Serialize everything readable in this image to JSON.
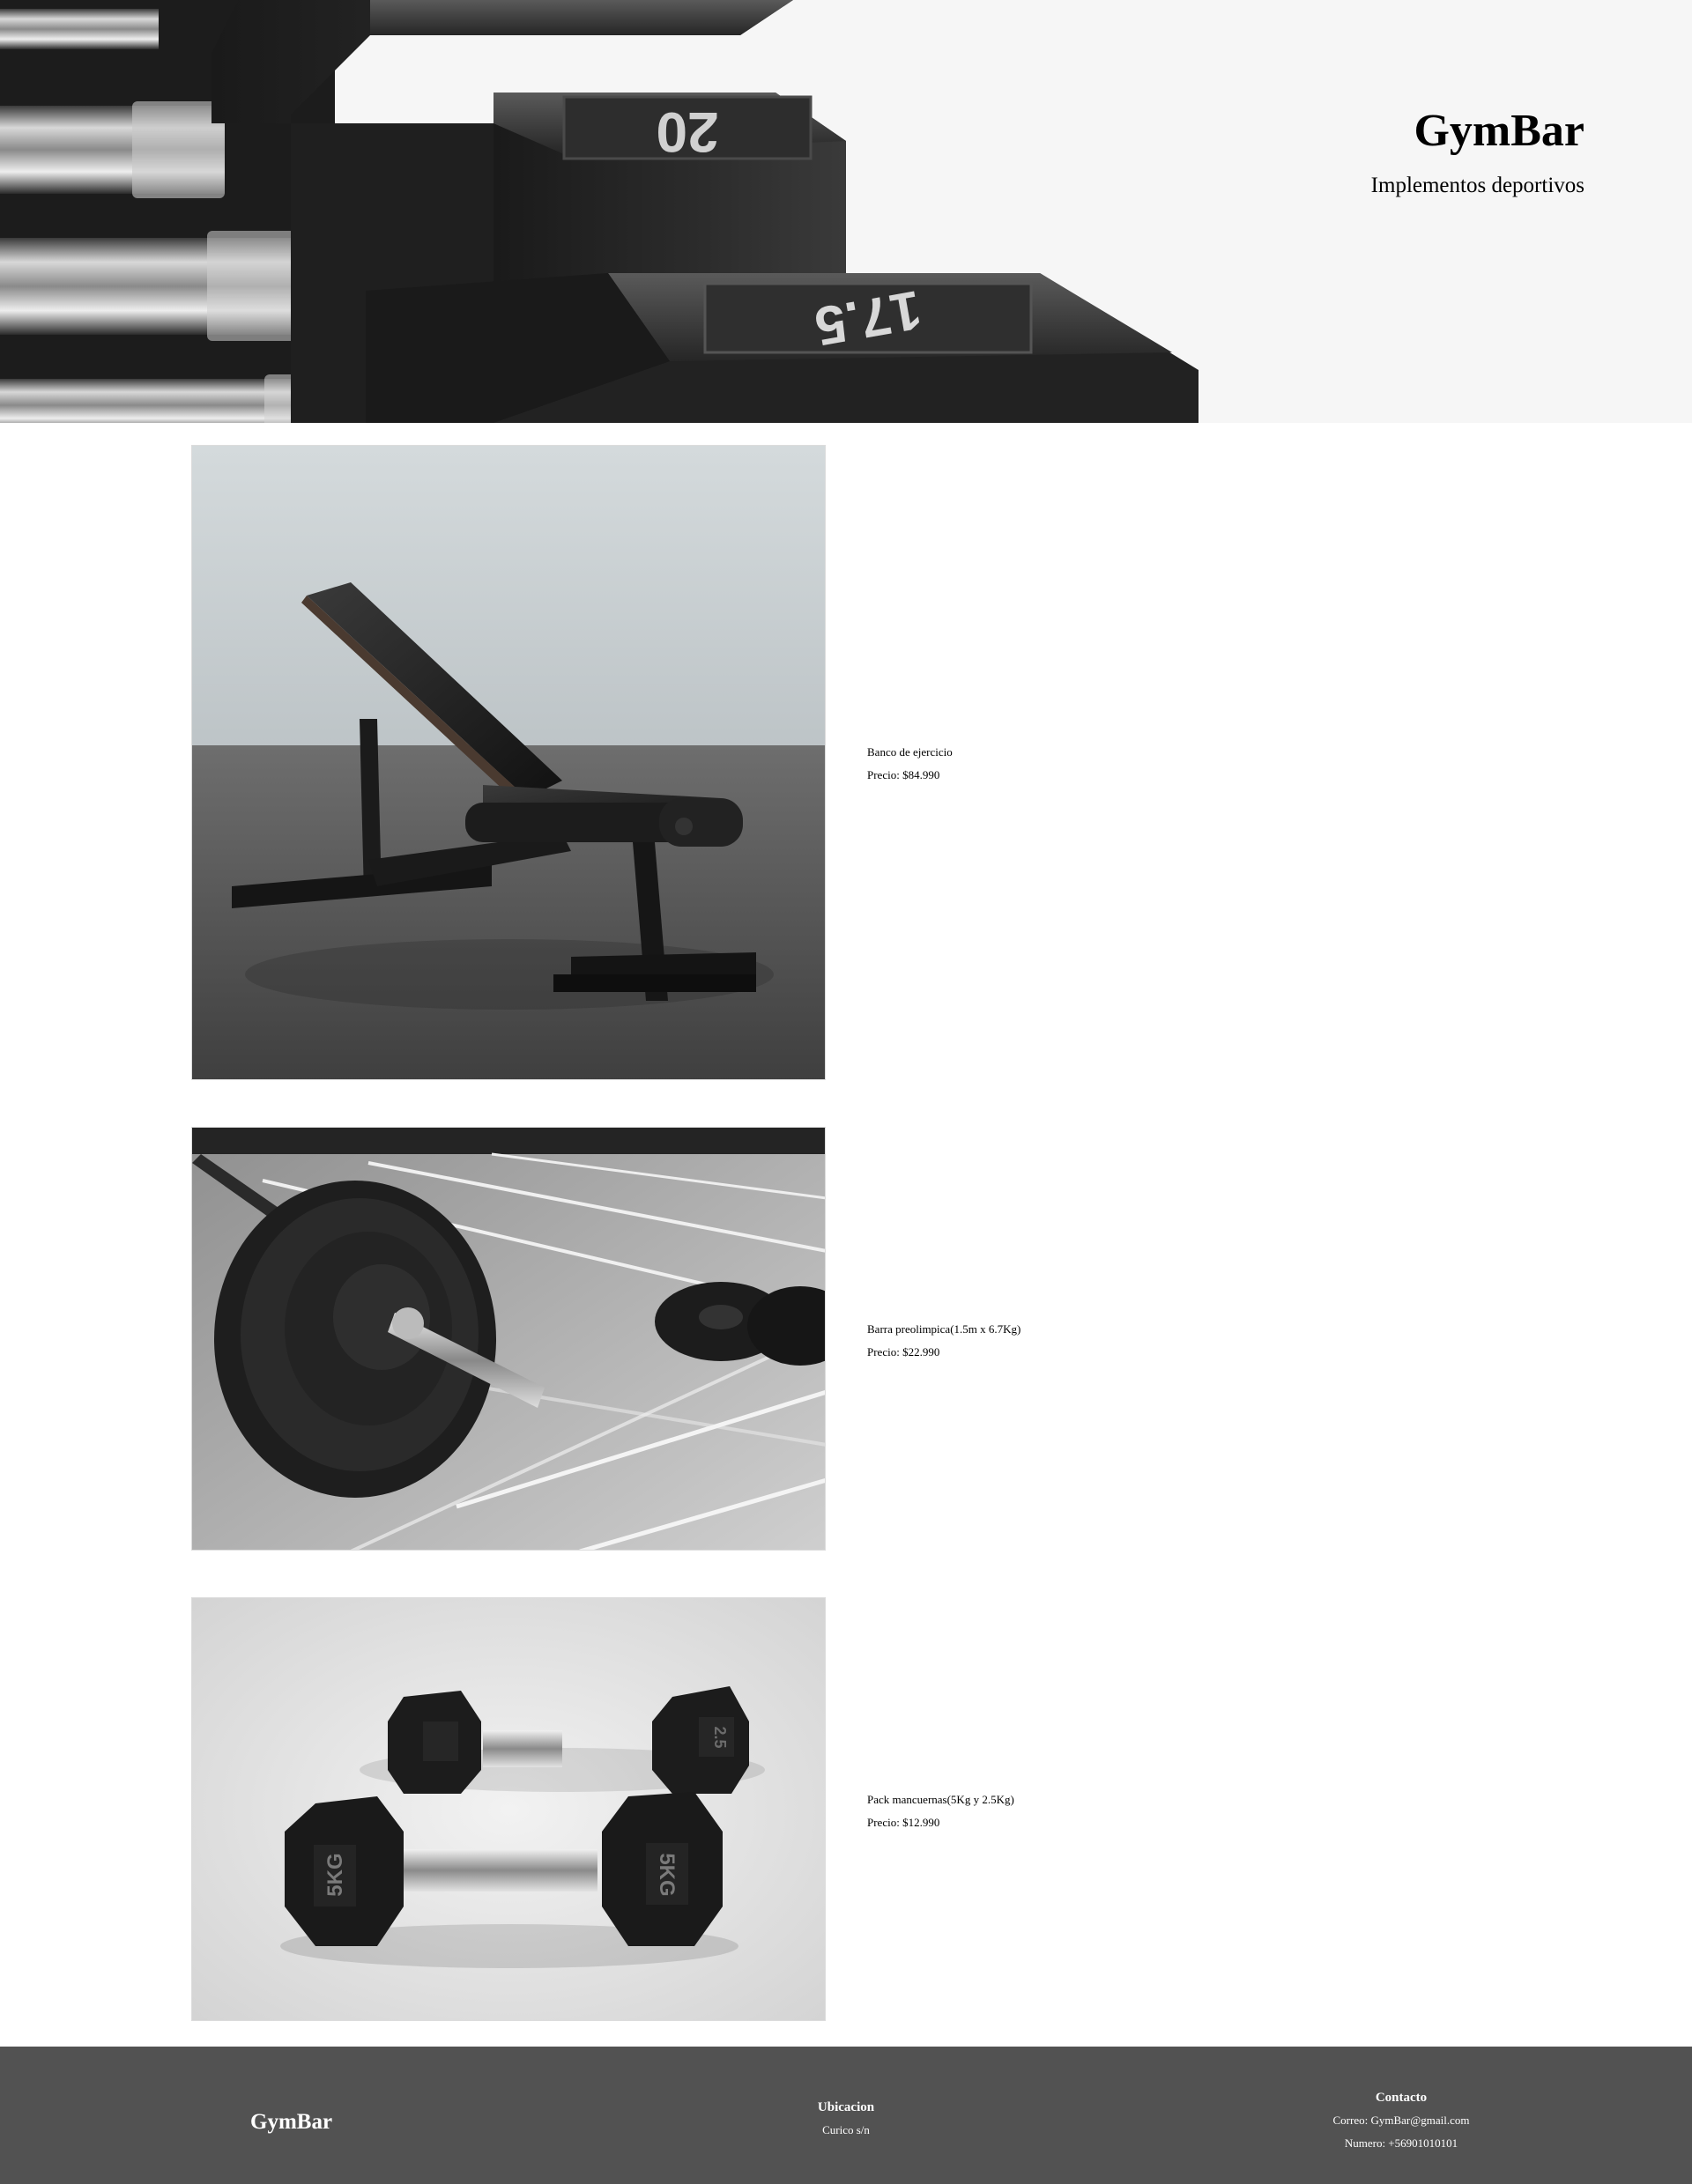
{
  "header": {
    "title": "GymBar",
    "subtitle": "Implementos deportivos",
    "hero_numbers": {
      "top": "20",
      "bottom": "17.5"
    }
  },
  "products": [
    {
      "name": "Banco de ejercicio",
      "price": "Precio: $84.990",
      "image": "adjustable-bench-photo"
    },
    {
      "name": "Barra preolimpica(1.5m x 6.7Kg)",
      "price": "Precio: $22.990",
      "image": "barbell-plates-photo"
    },
    {
      "name": "Pack mancuernas(5Kg y 2.5Kg)",
      "price": "Precio: $12.990",
      "image": "hex-dumbbells-photo",
      "dumbbell_labels": {
        "big": "5KG",
        "small": "2.5"
      }
    }
  ],
  "footer": {
    "brand": "GymBar",
    "ubicacion": {
      "heading": "Ubicacion",
      "line": "Curico s/n"
    },
    "contacto": {
      "heading": "Contacto",
      "email": "Correo: GymBar@gmail.com",
      "phone": "Numero: +56901010101"
    }
  },
  "colors": {
    "footer_bg": "#525252",
    "hero_bg": "#f6f6f6",
    "text": "#000000"
  }
}
